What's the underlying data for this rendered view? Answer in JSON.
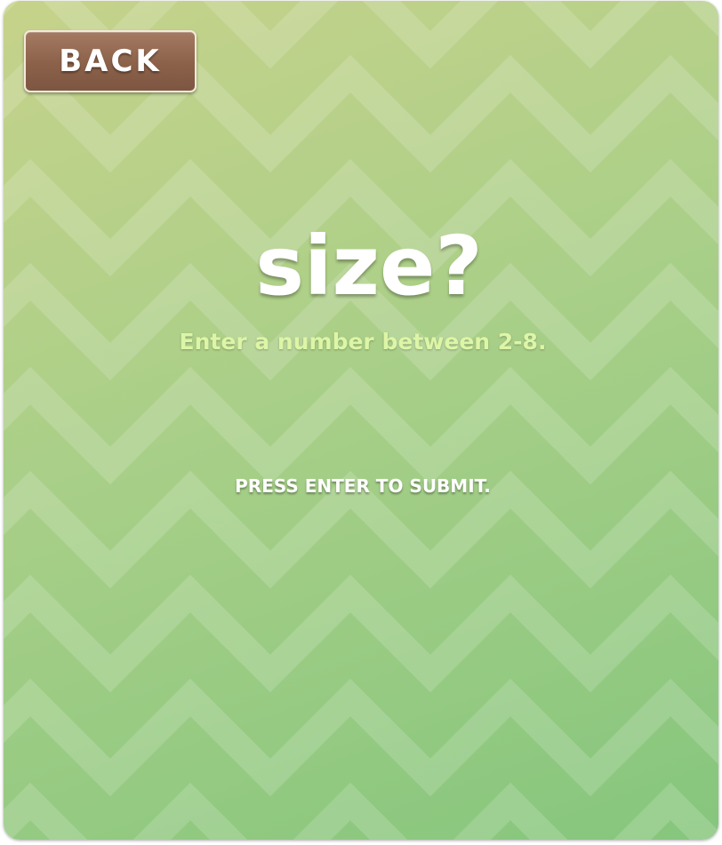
{
  "back_button": {
    "label": "BACK"
  },
  "prompt": {
    "title": "size?",
    "instruction": "Enter a number between 2-8.",
    "hint": "PRESS ENTER TO SUBMIT."
  },
  "colors": {
    "background_top": "#c6d28a",
    "background_bottom": "#86c67d",
    "back_button": "#8c6149",
    "instruction_text": "#ddf5a6"
  }
}
